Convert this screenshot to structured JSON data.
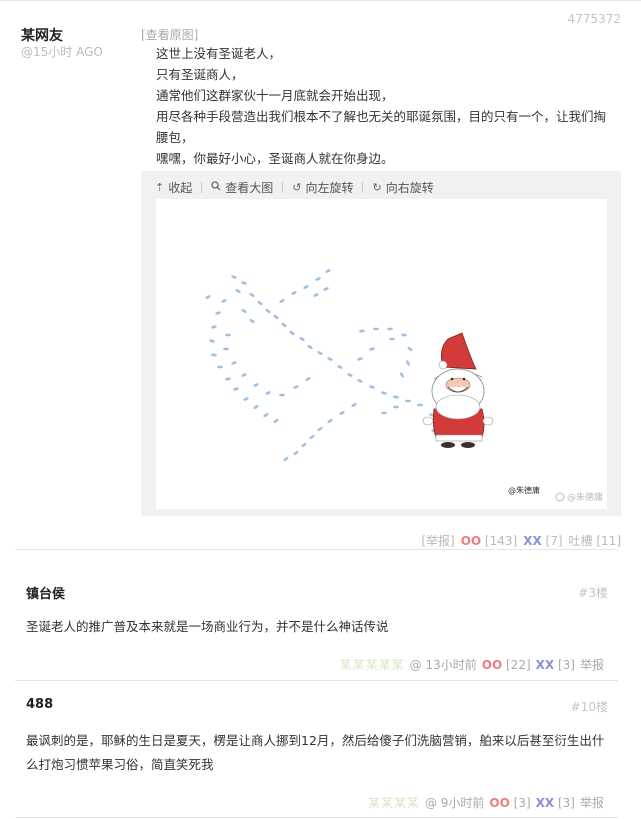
{
  "post": {
    "id": "4775372",
    "author": "某网友",
    "time": "@15小时 AGO",
    "view_original": "[查看原图]",
    "lines": [
      "这世上没有圣诞老人，",
      "只有圣诞商人，",
      "通常他们这群家伙十一月底就会开始出现，",
      "用尽各种手段营造出我们根本不了解也无关的耶诞氛围，目的只有一个，让我们掏腰包，",
      "嘿嘿，你最好小心，圣诞商人就在你身边。"
    ],
    "toolbar": {
      "collapse": "收起",
      "view_large": "查看大图",
      "rotate_left": "向左旋转",
      "rotate_right": "向右旋转"
    },
    "image_watermark": "@朱德庸",
    "image_signature": "@朱德庸",
    "actions": {
      "report": "[举报]",
      "oo_label": "OO",
      "oo_count": "[143]",
      "xx_label": "XX",
      "xx_count": "[7]",
      "comment": "吐槽 [11]"
    }
  },
  "comments": [
    {
      "author": "镇台侯",
      "floor": "#3楼",
      "text": "圣诞老人的推广普及本来就是一场商业行为，并不是什么神话传说",
      "meta_blur": "某某某某某",
      "time": "@ 13小时前",
      "oo_label": "OO",
      "oo_count": "[22]",
      "xx_label": "XX",
      "xx_count": "[3]",
      "report": "举报"
    },
    {
      "author": "488",
      "floor": "#10楼",
      "text": "最讽刺的是，耶稣的生日是夏天，楞是让商人挪到12月，然后给傻子们洗脑营销，舶来以后甚至衍生出什么打炮习惯苹果习俗，简直笑死我",
      "meta_blur": "某某某某",
      "time": "@ 9小时前",
      "oo_label": "OO",
      "oo_count": "[3]",
      "xx_label": "XX",
      "xx_count": "[3]",
      "report": "举报"
    }
  ]
}
